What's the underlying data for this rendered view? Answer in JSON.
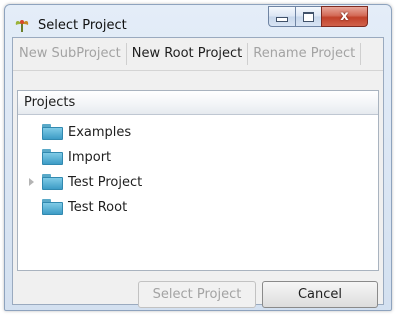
{
  "window": {
    "title": "Select Project",
    "icon": "app-logo-icon",
    "caption_buttons": {
      "minimize": "minimize-icon",
      "maximize": "maximize-icon",
      "close": "x"
    }
  },
  "toolbar": {
    "new_subproject_label": "New SubProject",
    "new_root_project_label": "New Root Project",
    "rename_project_label": "Rename Project"
  },
  "tree": {
    "header": "Projects",
    "items": [
      {
        "label": "Examples",
        "icon": "folder-icon",
        "expandable": false
      },
      {
        "label": "Import",
        "icon": "folder-icon",
        "expandable": false
      },
      {
        "label": "Test Project",
        "icon": "folder-icon",
        "expandable": true,
        "expanded": false
      },
      {
        "label": "Test Root",
        "icon": "folder-icon",
        "expandable": false
      }
    ]
  },
  "footer": {
    "select_project_label": "Select Project",
    "cancel_label": "Cancel"
  }
}
